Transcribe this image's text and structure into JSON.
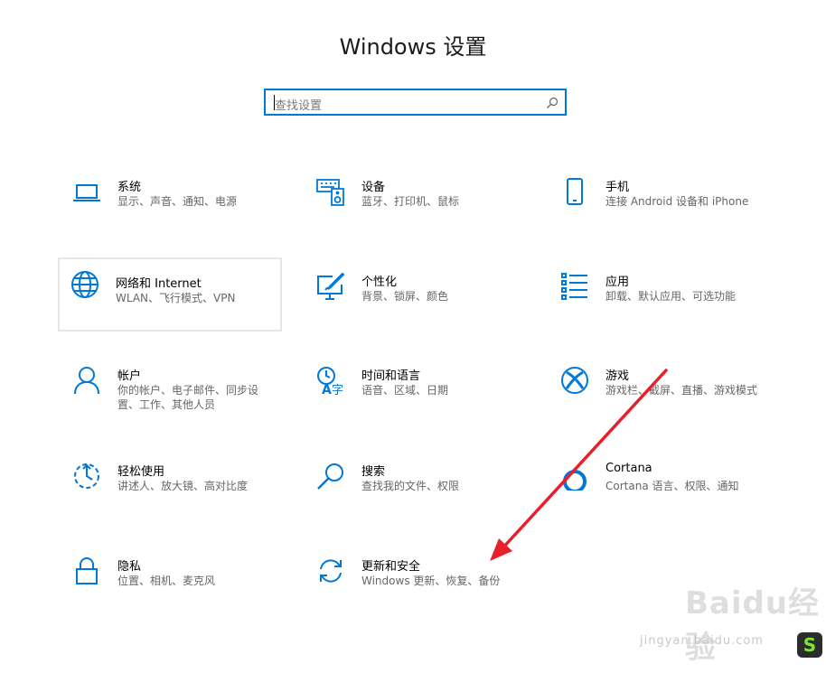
{
  "header": {
    "title": "Windows 设置"
  },
  "search": {
    "placeholder": "查找设置"
  },
  "settings": [
    {
      "name": "系统",
      "desc": "显示、声音、通知、电源",
      "icon": "laptop-icon"
    },
    {
      "name": "设备",
      "desc": "蓝牙、打印机、鼠标",
      "icon": "keyboard-speaker-icon"
    },
    {
      "name": "手机",
      "desc": "连接 Android 设备和 iPhone",
      "icon": "phone-icon"
    },
    {
      "name": "网络和 Internet",
      "desc": "WLAN、飞行模式、VPN",
      "icon": "globe-icon"
    },
    {
      "name": "个性化",
      "desc": "背景、锁屏、颜色",
      "icon": "monitor-pen-icon"
    },
    {
      "name": "应用",
      "desc": "卸载、默认应用、可选功能",
      "icon": "app-list-icon"
    },
    {
      "name": "帐户",
      "desc": "你的帐户、电子邮件、同步设置、工作、其他人员",
      "icon": "person-icon"
    },
    {
      "name": "时间和语言",
      "desc": "语音、区域、日期",
      "icon": "time-language-icon"
    },
    {
      "name": "游戏",
      "desc": "游戏栏、截屏、直播、游戏模式",
      "icon": "xbox-icon"
    },
    {
      "name": "轻松使用",
      "desc": "讲述人、放大镜、高对比度",
      "icon": "ease-of-access-icon"
    },
    {
      "name": "搜索",
      "desc": "查找我的文件、权限",
      "icon": "search-icon"
    },
    {
      "name": "Cortana",
      "desc": "Cortana 语言、权限、通知",
      "icon": "cortana-icon"
    },
    {
      "name": "隐私",
      "desc": "位置、相机、麦克风",
      "icon": "lock-icon"
    },
    {
      "name": "更新和安全",
      "desc": "Windows 更新、恢复、备份",
      "icon": "refresh-icon"
    }
  ],
  "watermark": {
    "brand": "Baidu经验",
    "url": "jingyan.baidu.com",
    "badge": "S"
  },
  "colors": {
    "accent": "#0078d7",
    "arrow": "#e8202b"
  }
}
